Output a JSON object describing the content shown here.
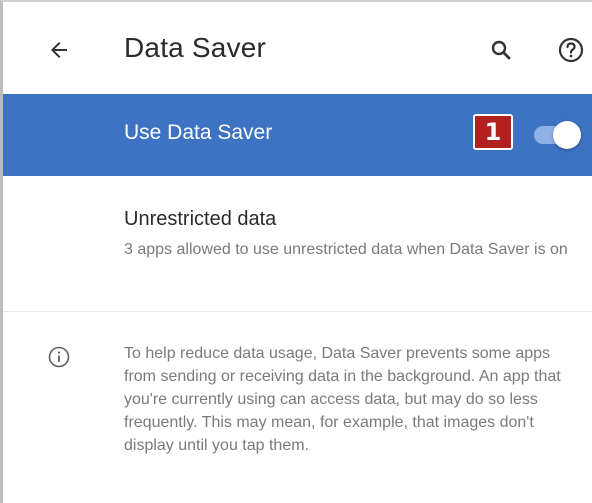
{
  "toolbar": {
    "title": "Data Saver",
    "back_icon": "arrow-back-icon",
    "search_icon": "search-icon",
    "help_icon": "help-icon"
  },
  "master_switch": {
    "label": "Use Data Saver",
    "badge": "1",
    "enabled": true
  },
  "unrestricted": {
    "title": "Unrestricted data",
    "subtitle": "3 apps allowed to use unrestricted data when Data Saver is on"
  },
  "info": {
    "icon": "info-icon",
    "text": "To help reduce data usage, Data Saver prevents some apps from sending or receiving data in the background. An app that you're currently using can access data, but may do so less frequently. This may mean, for example, that images don't display until you tap them."
  },
  "colors": {
    "accent": "#3e73c4",
    "badge": "#b3211e",
    "toggle_track": "#8fb1e6"
  }
}
